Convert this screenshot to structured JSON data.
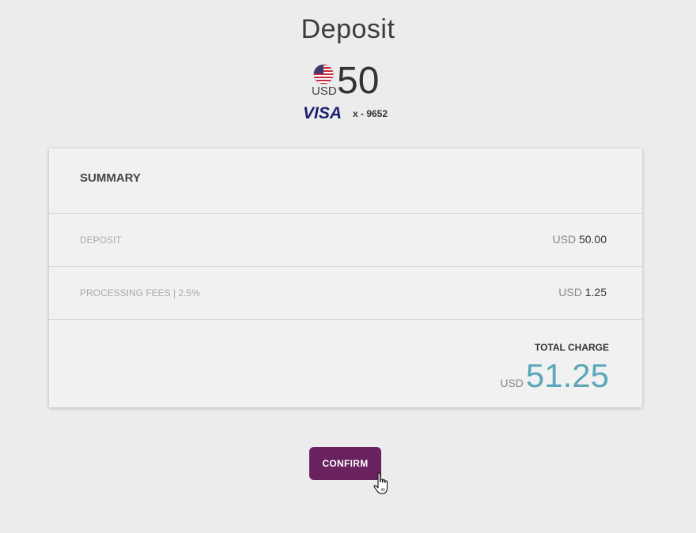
{
  "page": {
    "title": "Deposit"
  },
  "amount": {
    "currency": "USD",
    "value": "50",
    "flag_icon": "us-flag-icon"
  },
  "card": {
    "brand": "VISA",
    "masked_number": "x - 9652"
  },
  "summary": {
    "title": "SUMMARY",
    "rows": [
      {
        "label": "DEPOSIT",
        "currency": "USD",
        "value": "50.00"
      },
      {
        "label": "PROCESSING FEES | 2.5%",
        "currency": "USD",
        "value": "1.25"
      }
    ],
    "total": {
      "label": "TOTAL CHARGE",
      "currency": "USD",
      "value": "51.25"
    }
  },
  "actions": {
    "confirm_label": "CONFIRM"
  },
  "colors": {
    "brand_purple": "#6a2160",
    "total_accent": "#5ba6b8",
    "visa_blue": "#1a1f71"
  }
}
